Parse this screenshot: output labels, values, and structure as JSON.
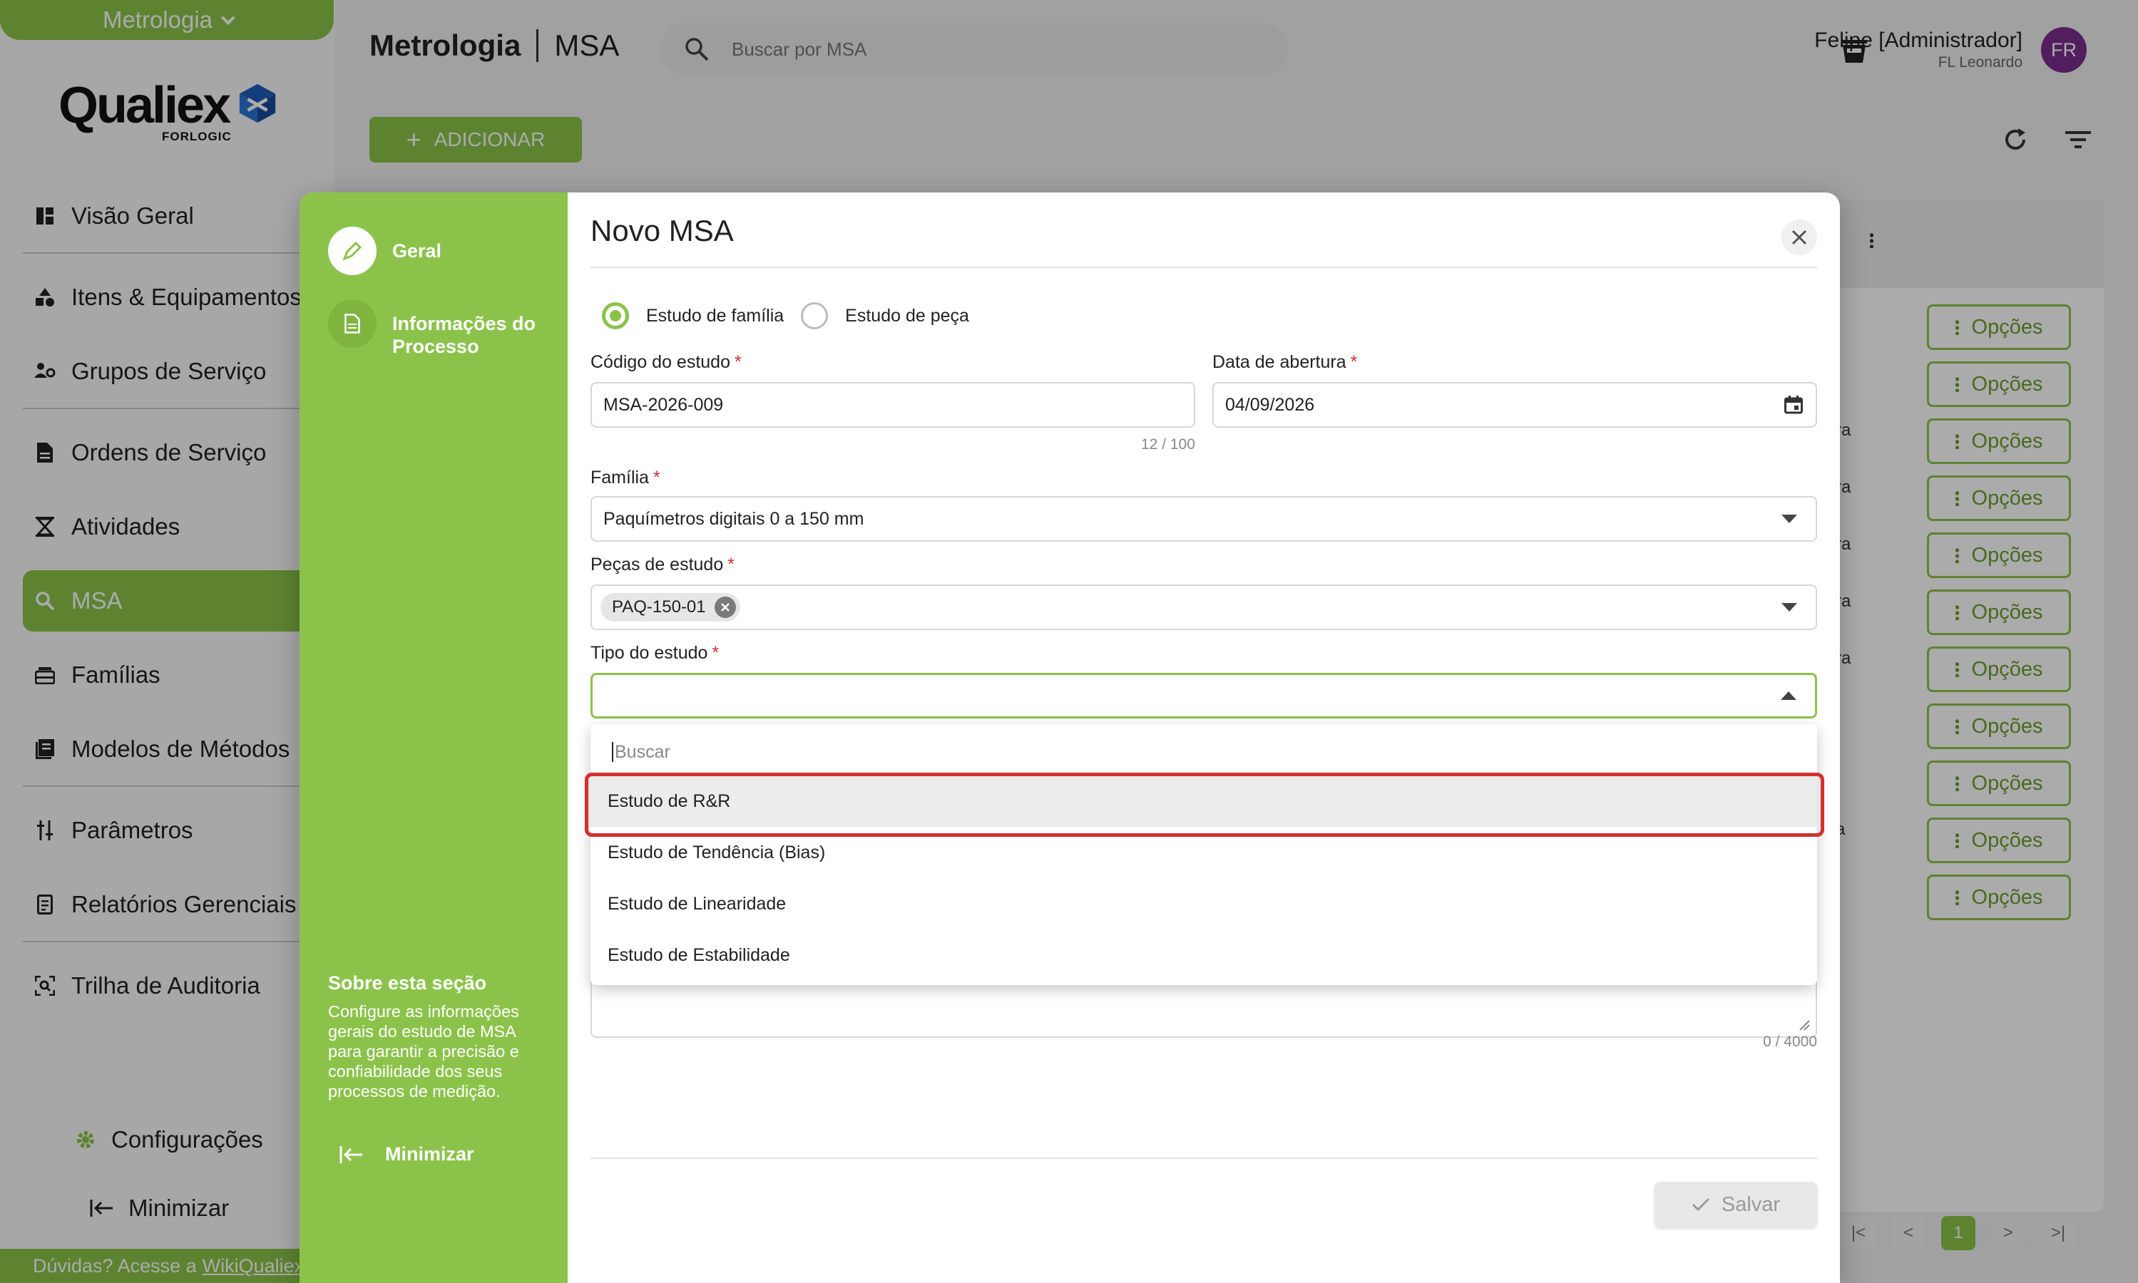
{
  "module": "Metrologia",
  "logo": {
    "word": "Qualiex",
    "sub": "FORLOGIC"
  },
  "nav": [
    {
      "label": "Visão Geral",
      "icon": "dashboard-icon"
    },
    {
      "label": "Itens & Equipamentos",
      "icon": "shapes-icon"
    },
    {
      "label": "Grupos de Serviço",
      "icon": "people-gear-icon"
    },
    {
      "label": "Ordens de Serviço",
      "icon": "document-icon"
    },
    {
      "label": "Atividades",
      "icon": "hourglass-icon"
    },
    {
      "label": "MSA",
      "icon": "magnify-icon"
    },
    {
      "label": "Famílias",
      "icon": "stack-icon"
    },
    {
      "label": "Modelos de Métodos",
      "icon": "book-icon"
    },
    {
      "label": "Parâmetros",
      "icon": "sliders-icon"
    },
    {
      "label": "Relatórios Gerenciais",
      "icon": "report-icon"
    },
    {
      "label": "Trilha de Auditoria",
      "icon": "audit-icon"
    }
  ],
  "settings_label": "Configurações",
  "sidebar_minimize": "Minimizar",
  "wiki": {
    "text": "Dúvidas? Acesse a",
    "link": "WikiQualiex"
  },
  "header": {
    "module": "Metrologia",
    "page": "MSA",
    "search_placeholder": "Buscar por MSA",
    "user_name": "Felipe [Administrador]",
    "user_company": "FL Leonardo",
    "avatar": "FR"
  },
  "add_label": "ADICIONAR",
  "list": {
    "options_label": "Opções",
    "options_count": 11,
    "row_fragments": [
      "ra",
      "ra",
      "ra",
      "ra",
      "ra",
      "ra",
      "a"
    ],
    "current_page": "1"
  },
  "modal": {
    "title": "Novo MSA",
    "steps": [
      {
        "label": "Geral",
        "active": true
      },
      {
        "label": "Informações do Processo",
        "active": false
      }
    ],
    "about_title": "Sobre esta seção",
    "about_text": "Configure as informações gerais do estudo de MSA para garantir a precisão e confiabilidade dos seus processos de medição.",
    "minimize_label": "Minimizar",
    "radio_family": "Estudo de família",
    "radio_piece": "Estudo de peça",
    "radio_selected": "family",
    "code_label": "Código do estudo",
    "code_value": "MSA-2026-009",
    "code_counter": "12 / 100",
    "date_label": "Data de abertura",
    "date_value": "04/09/2026",
    "family_label": "Família",
    "family_value": "Paquímetros digitais 0 a 150 mm",
    "pieces_label": "Peças de estudo",
    "pieces_chip": "PAQ-150-01",
    "type_label": "Tipo do estudo",
    "type_value": "",
    "dropdown_search_placeholder": "Buscar",
    "type_options": [
      "Estudo de R&R",
      "Estudo de Tendência (Bias)",
      "Estudo de Linearidade",
      "Estudo de Estabilidade"
    ],
    "description_counter": "0 / 4000",
    "save_label": "Salvar"
  },
  "colors": {
    "accent": "#8bc34a",
    "required": "#d32f2f",
    "highlight": "#d32f2f",
    "avatar": "#7b2d8e"
  }
}
